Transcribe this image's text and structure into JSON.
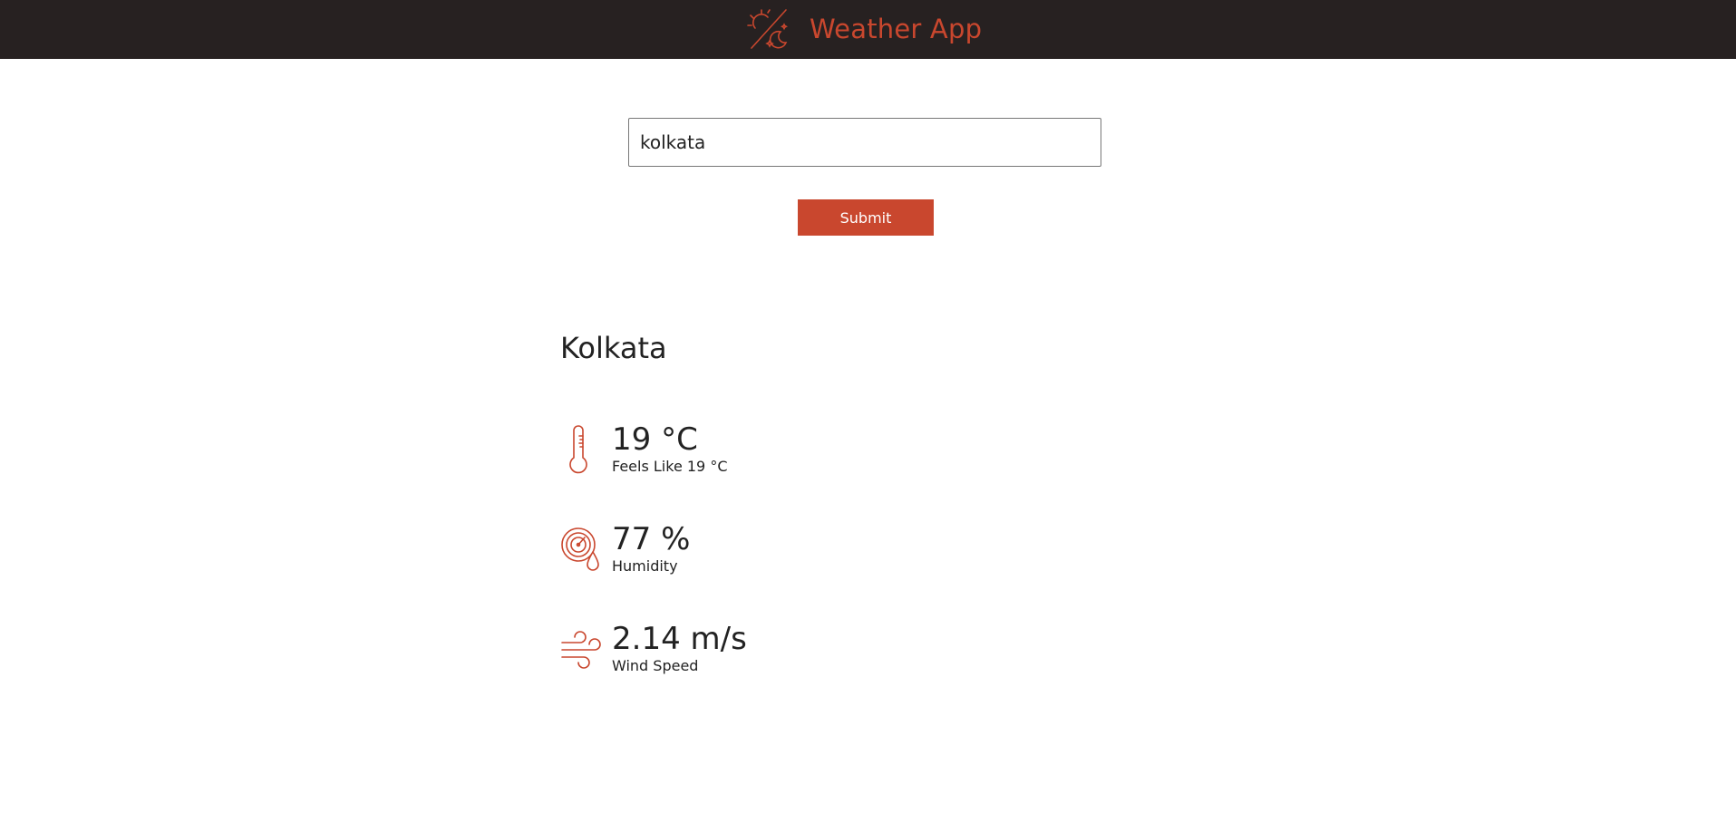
{
  "header": {
    "title": "Weather App",
    "icon": "sun-moon-icon",
    "accent_color": "#c9472e",
    "bg_color": "#272121"
  },
  "search": {
    "value": "kolkata"
  },
  "submit": {
    "label": "Submit"
  },
  "weather": {
    "city": "Kolkata",
    "temperature": {
      "value": "19 °C",
      "label": "Feels Like 19 °C",
      "icon": "thermometer-icon"
    },
    "humidity": {
      "value": "77 %",
      "label": "Humidity",
      "icon": "humidity-gauge-icon"
    },
    "wind": {
      "value": "2.14 m/s",
      "label": "Wind Speed",
      "icon": "wind-icon"
    }
  }
}
